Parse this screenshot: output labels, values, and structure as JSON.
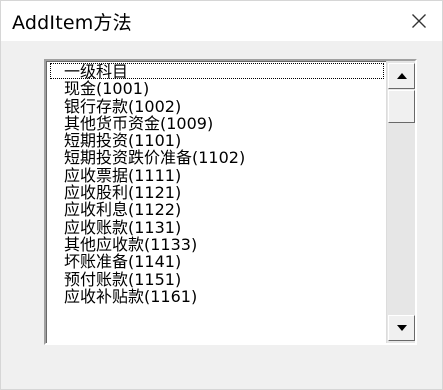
{
  "window": {
    "title": "AddItem方法"
  },
  "listbox": {
    "items": [
      "一级科目",
      "现金(1001)",
      "银行存款(1002)",
      "其他货币资金(1009)",
      "短期投资(1101)",
      "短期投资跌价准备(1102)",
      "应收票据(1111)",
      "应收股利(1121)",
      "应收利息(1122)",
      "应收账款(1131)",
      "其他应收款(1133)",
      "坏账准备(1141)",
      "预付账款(1151)",
      "应收补贴款(1161)"
    ]
  },
  "icons": {
    "close": "close-icon",
    "scroll_up": "scroll-up-arrow-icon",
    "scroll_down": "scroll-down-arrow-icon"
  }
}
